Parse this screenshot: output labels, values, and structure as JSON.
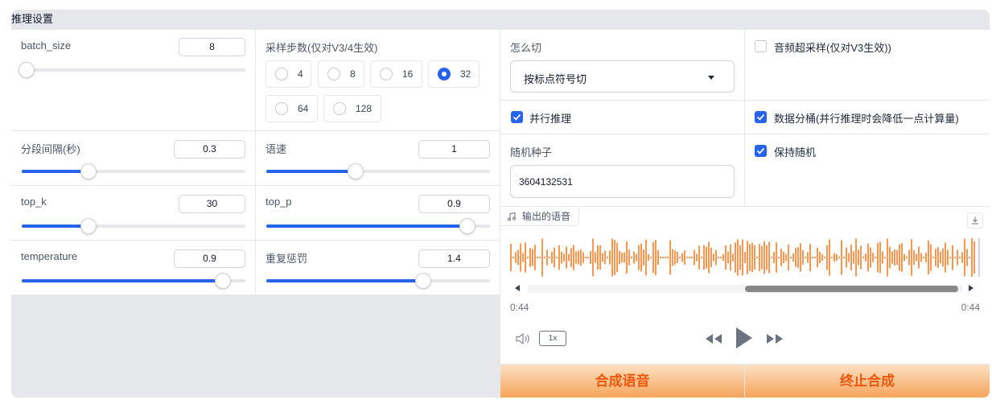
{
  "panel": {
    "title": "推理设置"
  },
  "batch_size": {
    "label": "batch_size",
    "value": "8",
    "level": 0.02
  },
  "sample_steps": {
    "label": "采样步数(仅对V3/4生效)",
    "options": [
      "4",
      "8",
      "16",
      "32",
      "64",
      "128"
    ],
    "selected": "32"
  },
  "cut_method": {
    "label": "怎么切",
    "selected": "按标点符号切"
  },
  "super_sampling": {
    "label": "音频超采样(仅对V3生效))",
    "checked": false
  },
  "segment_interval": {
    "label": "分段间隔(秒)",
    "value": "0.3",
    "level": 0.3
  },
  "speed": {
    "label": "语速",
    "value": "1",
    "level": 0.4
  },
  "parallel_infer": {
    "label": "并行推理",
    "checked": true
  },
  "data_bucket": {
    "label": "数据分桶(并行推理时会降低一点计算量)",
    "checked": true
  },
  "random_seed": {
    "label": "随机种子",
    "value": "3604132531"
  },
  "keep_random": {
    "label": "保持随机",
    "checked": true
  },
  "top_k": {
    "label": "top_k",
    "value": "30",
    "level": 0.3
  },
  "top_p": {
    "label": "top_p",
    "value": "0.9",
    "level": 0.9
  },
  "temperature": {
    "label": "temperature",
    "value": "0.9",
    "level": 0.9
  },
  "repetition_penalty": {
    "label": "重复惩罚",
    "value": "1.4",
    "level": 0.7
  },
  "audio": {
    "label": "输出的语音",
    "current_time": "0:44",
    "duration": "0:44",
    "playback_rate": "1x",
    "scroll_position": 0.5,
    "colors": {
      "waveform": "#f97316",
      "scrollbar": "#888888"
    }
  },
  "buttons": {
    "synthesize": "合成语音",
    "stop": "终止合成"
  },
  "colors": {
    "accent": "#2563eb",
    "action_text": "#ea580c",
    "action_bg_top": "#fde1c4",
    "action_bg_bottom": "#f5a45c"
  }
}
